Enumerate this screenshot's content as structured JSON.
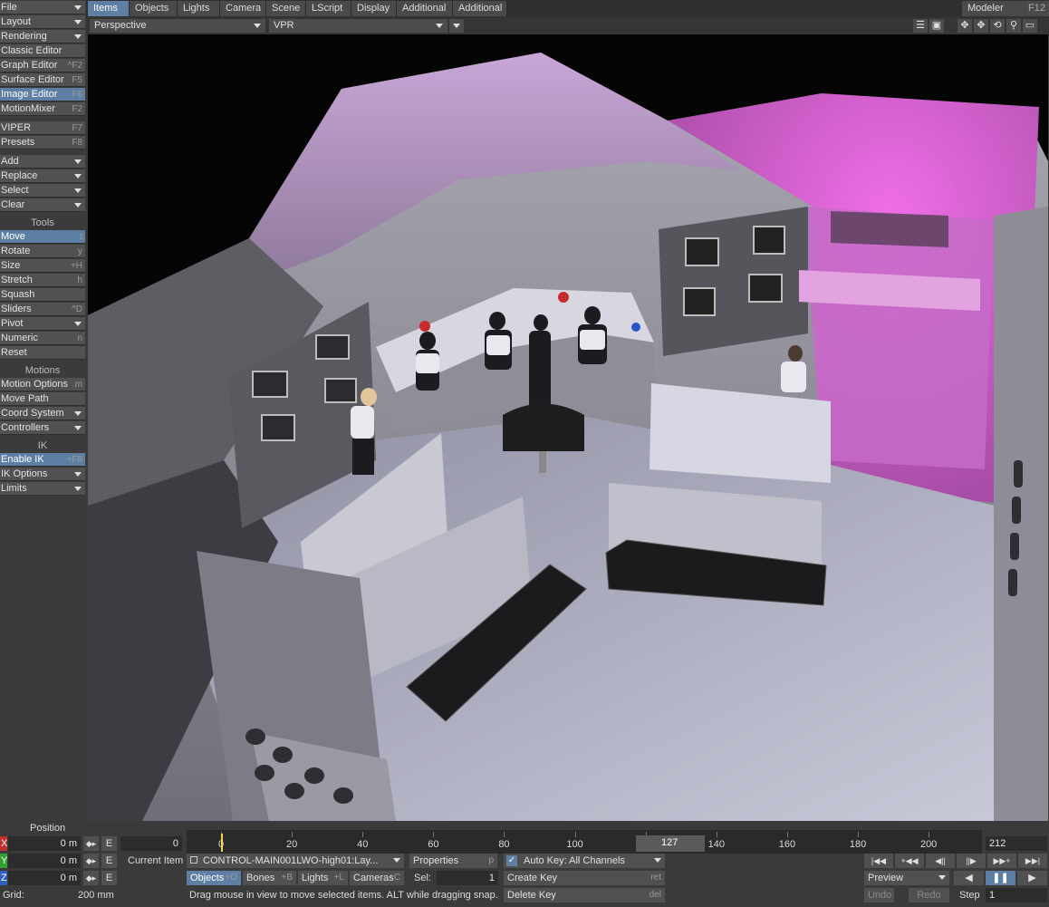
{
  "left_toolbar": {
    "groups_top": [
      {
        "label": "File",
        "dropdown": true
      },
      {
        "label": "Layout",
        "dropdown": true
      },
      {
        "label": "Rendering",
        "dropdown": true
      },
      {
        "label": "Classic Editor",
        "shortcut": ""
      },
      {
        "label": "Graph Editor",
        "shortcut": "^F2"
      },
      {
        "label": "Surface Editor",
        "shortcut": "F5"
      },
      {
        "label": "Image Editor",
        "shortcut": "F6",
        "active": true
      },
      {
        "label": "MotionMixer",
        "shortcut": "F2"
      },
      {
        "label": "VIPER",
        "shortcut": "F7"
      },
      {
        "label": "Presets",
        "shortcut": "F8"
      },
      {
        "label": "Add",
        "dropdown": true
      },
      {
        "label": "Replace",
        "dropdown": true
      },
      {
        "label": "Select",
        "dropdown": true
      },
      {
        "label": "Clear",
        "dropdown": true
      }
    ],
    "tools_header": "Tools",
    "tools": [
      {
        "label": "Move",
        "shortcut": "t",
        "active": true
      },
      {
        "label": "Rotate",
        "shortcut": "y"
      },
      {
        "label": "Size",
        "shortcut": "+H"
      },
      {
        "label": "Stretch",
        "shortcut": "h"
      },
      {
        "label": "Squash",
        "shortcut": ""
      },
      {
        "label": "Sliders",
        "shortcut": "^D"
      },
      {
        "label": "Pivot",
        "dropdown": true
      },
      {
        "label": "Numeric",
        "shortcut": "n"
      },
      {
        "label": "Reset",
        "shortcut": ""
      }
    ],
    "motions_header": "Motions",
    "motions": [
      {
        "label": "Motion Options",
        "shortcut": "m"
      },
      {
        "label": "Move Path",
        "shortcut": ""
      },
      {
        "label": "Coord System",
        "dropdown": true
      },
      {
        "label": "Controllers",
        "dropdown": true
      }
    ],
    "ik_header": "IK",
    "ik": [
      {
        "label": "Enable IK",
        "shortcut": "+F8",
        "active": true
      },
      {
        "label": "IK Options",
        "dropdown": true
      },
      {
        "label": "Limits",
        "dropdown": true
      }
    ]
  },
  "tabs": [
    "Items",
    "Objects",
    "Lights",
    "Camera",
    "Scene",
    "LScript",
    "Display",
    "Additional",
    "Additional"
  ],
  "active_tab": 0,
  "modeler": {
    "label": "Modeler",
    "shortcut": "F12"
  },
  "viewport": {
    "view_mode": "Perspective",
    "render_mode": "VPR"
  },
  "bottom": {
    "position_label": "Position",
    "x": {
      "axis": "X",
      "value": "0 m",
      "color": "#c03030"
    },
    "y": {
      "axis": "Y",
      "value": "0 m",
      "color": "#30a030"
    },
    "z": {
      "axis": "Z",
      "value": "0 m",
      "color": "#3060c0"
    },
    "e_label": "E",
    "grid_label": "Grid:",
    "grid_value": "200 mm",
    "timeline": {
      "start": "0",
      "end": "212",
      "current": "127",
      "ticks": [
        "0",
        "20",
        "40",
        "60",
        "80",
        "100",
        "120",
        "140",
        "160",
        "180",
        "200"
      ]
    },
    "current_item_label": "Current Item",
    "current_item_value": "CONTROL-MAIN001LWO-high01:Lay...",
    "properties_label": "Properties",
    "properties_shortcut": "p",
    "selection_tabs": [
      {
        "label": "Objects",
        "shortcut": "+O",
        "active": true
      },
      {
        "label": "Bones",
        "shortcut": "+B"
      },
      {
        "label": "Lights",
        "shortcut": "+L"
      },
      {
        "label": "Cameras",
        "shortcut": "+C"
      }
    ],
    "sel_label": "Sel:",
    "sel_value": "1",
    "autokey_label": "Auto Key: All Channels",
    "create_key": "Create Key",
    "create_key_sc": "ret",
    "delete_key": "Delete Key",
    "delete_key_sc": "del",
    "status_text": "Drag mouse in view to move selected items. ALT while dragging snap...",
    "preview_label": "Preview",
    "undo_label": "Undo",
    "redo_label": "Redo",
    "step_label": "Step",
    "step_value": "1",
    "transport": [
      "|◀◀",
      "+◀◀",
      "◀||",
      "||▶",
      "▶▶+",
      "▶▶|"
    ]
  }
}
